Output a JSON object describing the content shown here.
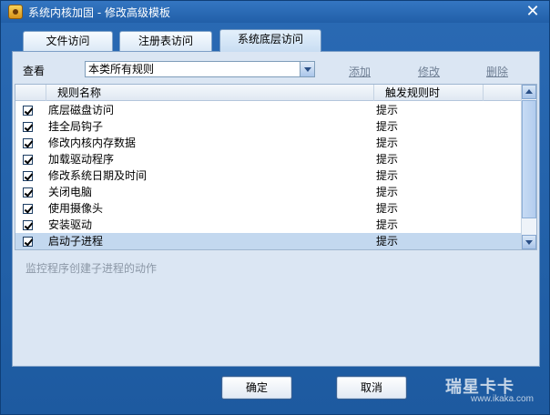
{
  "window": {
    "title": "系统内核加固  -  修改高级模板",
    "close_symbol": "✕"
  },
  "tabs": [
    {
      "label": "文件访问",
      "active": false
    },
    {
      "label": "注册表访问",
      "active": false
    },
    {
      "label": "系统底层访问",
      "active": true
    }
  ],
  "filter": {
    "label": "查看",
    "selected": "本类所有规则"
  },
  "actions": {
    "add": "添加",
    "edit": "修改",
    "delete": "删除"
  },
  "table": {
    "columns": [
      "规则名称",
      "触发规则时"
    ],
    "rows": [
      {
        "checked": true,
        "name": "底层磁盘访问",
        "trigger": "提示"
      },
      {
        "checked": true,
        "name": "挂全局钩子",
        "trigger": "提示"
      },
      {
        "checked": true,
        "name": "修改内核内存数据",
        "trigger": "提示"
      },
      {
        "checked": true,
        "name": "加载驱动程序",
        "trigger": "提示"
      },
      {
        "checked": true,
        "name": "修改系统日期及时间",
        "trigger": "提示"
      },
      {
        "checked": true,
        "name": "关闭电脑",
        "trigger": "提示"
      },
      {
        "checked": true,
        "name": "使用摄像头",
        "trigger": "提示"
      },
      {
        "checked": true,
        "name": "安装驱动",
        "trigger": "提示"
      },
      {
        "checked": true,
        "name": "启动子进程",
        "trigger": "提示",
        "selected": true
      }
    ]
  },
  "description": "监控程序创建子进程的动作",
  "buttons": {
    "ok": "确定",
    "cancel": "取消"
  },
  "watermark": {
    "logo": "瑞星卡卡",
    "url": "www.ikaka.com"
  }
}
